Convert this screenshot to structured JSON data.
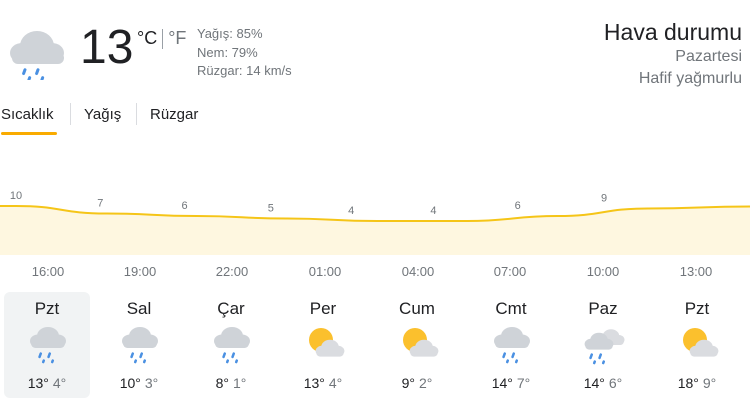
{
  "current": {
    "temperature": "13",
    "unit_c": "°C",
    "unit_f": "°F",
    "precipitation": "Yağış: 85%",
    "humidity": "Nem: 79%",
    "wind": "Rüzgar: 14 km/s",
    "icon": "rain-cloud-icon"
  },
  "header": {
    "title": "Hava durumu",
    "day": "Pazartesi",
    "condition": "Hafif yağmurlu"
  },
  "tabs": [
    {
      "label": "Sıcaklık",
      "active": true
    },
    {
      "label": "Yağış",
      "active": false
    },
    {
      "label": "Rüzgar",
      "active": false
    }
  ],
  "colors": {
    "accent": "#f9ab00",
    "chart_line": "#f5c518",
    "chart_fill": "#fef7e0"
  },
  "chart_data": {
    "type": "area",
    "x": [
      "16:00",
      "19:00",
      "22:00",
      "01:00",
      "04:00",
      "07:00",
      "10:00",
      "13:00"
    ],
    "values": [
      10,
      7,
      6,
      5,
      4,
      4,
      6,
      9
    ],
    "series": [
      {
        "values": [
          10,
          7,
          6,
          5,
          4,
          4,
          6,
          9
        ]
      }
    ]
  },
  "times": [
    "16:00",
    "19:00",
    "22:00",
    "01:00",
    "04:00",
    "07:00",
    "10:00",
    "13:00"
  ],
  "forecast": [
    {
      "day": "Pzt",
      "hi": "13°",
      "lo": "4°",
      "icon": "rain-cloud-icon",
      "selected": true
    },
    {
      "day": "Sal",
      "hi": "10°",
      "lo": "3°",
      "icon": "rain-cloud-icon",
      "selected": false
    },
    {
      "day": "Çar",
      "hi": "8°",
      "lo": "1°",
      "icon": "rain-cloud-icon",
      "selected": false
    },
    {
      "day": "Per",
      "hi": "13°",
      "lo": "4°",
      "icon": "partly-sunny-icon",
      "selected": false
    },
    {
      "day": "Cum",
      "hi": "9°",
      "lo": "2°",
      "icon": "partly-sunny-icon",
      "selected": false
    },
    {
      "day": "Cmt",
      "hi": "14°",
      "lo": "7°",
      "icon": "rain-cloud-icon",
      "selected": false
    },
    {
      "day": "Paz",
      "hi": "14°",
      "lo": "6°",
      "icon": "scattered-showers-icon",
      "selected": false
    },
    {
      "day": "Pzt",
      "hi": "18°",
      "lo": "9°",
      "icon": "partly-sunny-icon",
      "selected": false
    }
  ]
}
